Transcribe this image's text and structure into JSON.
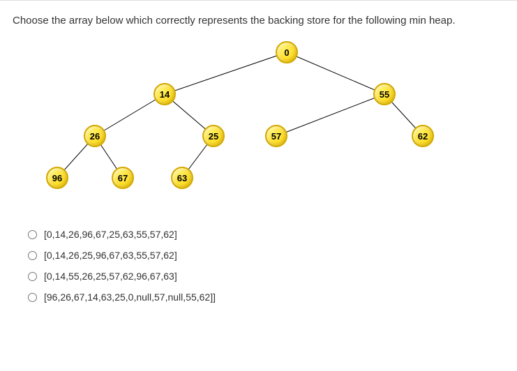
{
  "question": "Choose the array below which correctly represents the backing store for the following min heap.",
  "nodes": {
    "root": "0",
    "n14": "14",
    "n55": "55",
    "n26": "26",
    "n25": "25",
    "n57": "57",
    "n62": "62",
    "n96": "96",
    "n67": "67",
    "n63": "63"
  },
  "options": [
    "[0,14,26,96,67,25,63,55,57,62]",
    "[0,14,26,25,96,67,63,55,57,62]",
    "[0,14,55,26,25,57,62,96,67,63]",
    "[96,26,67,14,63,25,0,null,57,null,55,62]]"
  ]
}
